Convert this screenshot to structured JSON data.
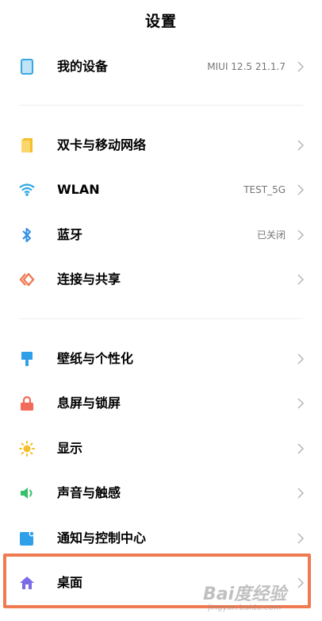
{
  "header": {
    "title": "设置"
  },
  "items": {
    "my_device": {
      "label": "我的设备",
      "value": "MIUI 12.5 21.1.7",
      "icon": "phone-icon",
      "icon_color": "#3aa8e0"
    },
    "dual_sim": {
      "label": "双卡与移动网络",
      "icon": "sim-card-icon",
      "icon_color": "#f5bf2a"
    },
    "wlan": {
      "label": "WLAN",
      "value": "TEST_5G",
      "icon": "wifi-icon",
      "icon_color": "#2aa6e6"
    },
    "bluetooth": {
      "label": "蓝牙",
      "value": "已关闭",
      "icon": "bluetooth-icon",
      "icon_color": "#2e8ee6"
    },
    "connection_sharing": {
      "label": "连接与共享",
      "icon": "share-icon",
      "icon_color": "#f07a52"
    },
    "wallpaper": {
      "label": "壁纸与个性化",
      "icon": "paintbrush-icon",
      "icon_color": "#2e9fe8"
    },
    "lock_screen": {
      "label": "息屏与锁屏",
      "icon": "lock-icon",
      "icon_color": "#f26a5a"
    },
    "display": {
      "label": "显示",
      "icon": "sun-icon",
      "icon_color": "#f5bf2a"
    },
    "sound": {
      "label": "声音与触感",
      "icon": "speaker-icon",
      "icon_color": "#35c26b"
    },
    "notifications": {
      "label": "通知与控制中心",
      "icon": "notification-icon",
      "icon_color": "#2e9fe8"
    },
    "home_screen": {
      "label": "桌面",
      "icon": "home-icon",
      "icon_color": "#7a6be6"
    }
  },
  "highlight": {
    "color": "#f07a52",
    "target": "home_screen"
  },
  "watermark": {
    "logo": "Bai度经验",
    "url": "jingyan.baidu.com"
  }
}
